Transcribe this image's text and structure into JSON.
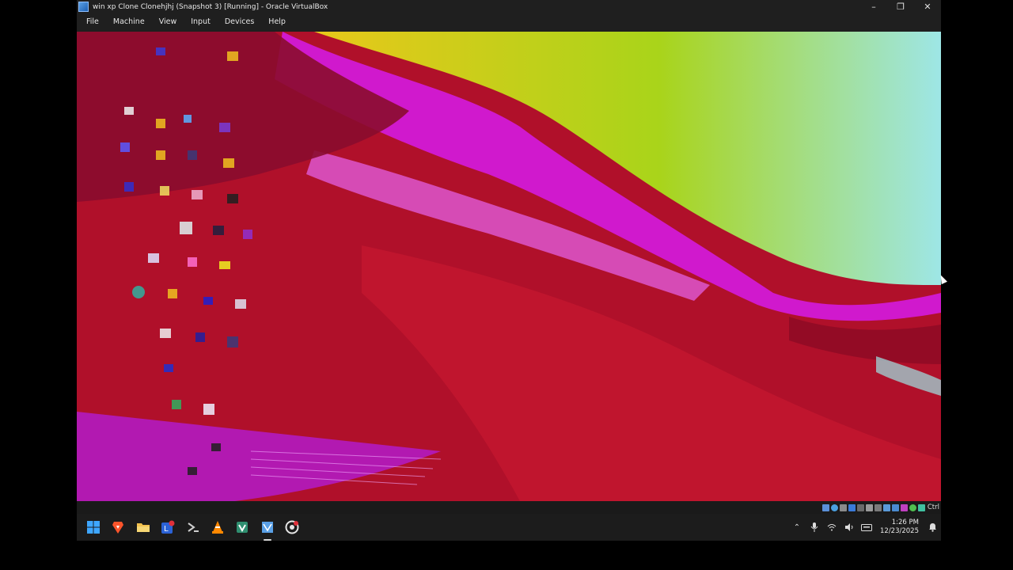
{
  "window": {
    "title": "win xp Clone Clonehjhj (Snapshot 3) [Running] - Oracle VirtualBox",
    "controls": [
      "minimize-icon",
      "restore-icon",
      "close-icon"
    ]
  },
  "menu": {
    "items": [
      "File",
      "Machine",
      "View",
      "Input",
      "Devices",
      "Help"
    ]
  },
  "statusbar": {
    "host_key": "Ctrl",
    "icons": [
      "hard-disk-icon",
      "optical-drive-icon",
      "audio-icon",
      "network-icon",
      "usb-icon",
      "shared-folders-icon",
      "display-icon",
      "recording-icon",
      "cpu-icon",
      "mouse-integration-icon",
      "keyboard-icon"
    ]
  },
  "taskbar": {
    "apps": [
      {
        "name": "windows-start-icon",
        "color": "#3ea6ff",
        "active": false
      },
      {
        "name": "brave-browser-icon",
        "color": "#fb542b",
        "active": false
      },
      {
        "name": "file-explorer-icon",
        "color": "#f2c14e",
        "active": false
      },
      {
        "name": "app-with-notification-icon",
        "color": "#2b62d6",
        "active": false
      },
      {
        "name": "terminal-icon",
        "color": "#cfcfcf",
        "active": false
      },
      {
        "name": "vlc-icon",
        "color": "#ff8800",
        "active": false
      },
      {
        "name": "visual-studio-installer-icon",
        "color": "#3fb58d",
        "active": false
      },
      {
        "name": "virtualbox-icon",
        "color": "#5aa0e6",
        "active": true
      },
      {
        "name": "chrome-canary-icon",
        "color": "#e6e6e6",
        "active": false
      }
    ],
    "tray": {
      "icons": [
        "show-hidden-icons-chevron",
        "microphone-icon",
        "wifi-icon",
        "speaker-icon",
        "keyboard-layout-icon"
      ],
      "time": "1:26 PM",
      "date": "12/23/2025",
      "notification": "notification-icon"
    }
  },
  "colors": {
    "chrome_bg": "#1f1f1f",
    "taskbar_bg": "#1c1c1c",
    "wallpaper_red": "#b0102a",
    "wallpaper_magenta": "#d21ad6",
    "wallpaper_yellow": "#e8d01a",
    "wallpaper_green": "#a9d41a",
    "wallpaper_cyan": "#9ee6e6"
  }
}
